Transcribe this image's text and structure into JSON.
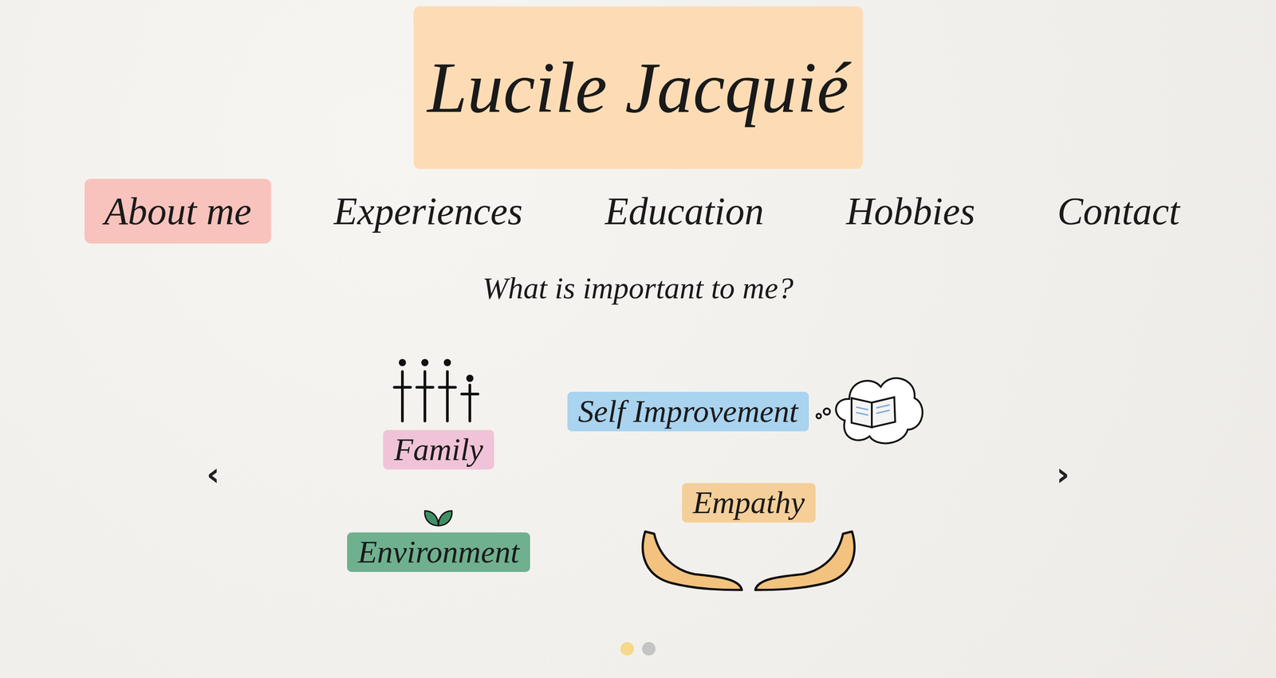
{
  "header": {
    "title": "Lucile Jacquié"
  },
  "nav": [
    {
      "label": "About me",
      "selected": true
    },
    {
      "label": "Experiences",
      "selected": false
    },
    {
      "label": "Education",
      "selected": false
    },
    {
      "label": "Hobbies",
      "selected": false
    },
    {
      "label": "Contact",
      "selected": false
    }
  ],
  "section": {
    "heading": "What is important to me?"
  },
  "carousel": {
    "prev": "‹",
    "next": "›",
    "values": [
      {
        "label": "Family",
        "kind": "people",
        "color": "#f0c3d8"
      },
      {
        "label": "Self Improvement",
        "kind": "book",
        "color": "#a9d3ee"
      },
      {
        "label": "Environment",
        "kind": "leaf",
        "color": "#6fb08f"
      },
      {
        "label": "Empathy",
        "kind": "hands",
        "color": "#f5cf9a"
      }
    ],
    "dots": [
      {
        "selected": true
      },
      {
        "selected": false
      }
    ]
  }
}
